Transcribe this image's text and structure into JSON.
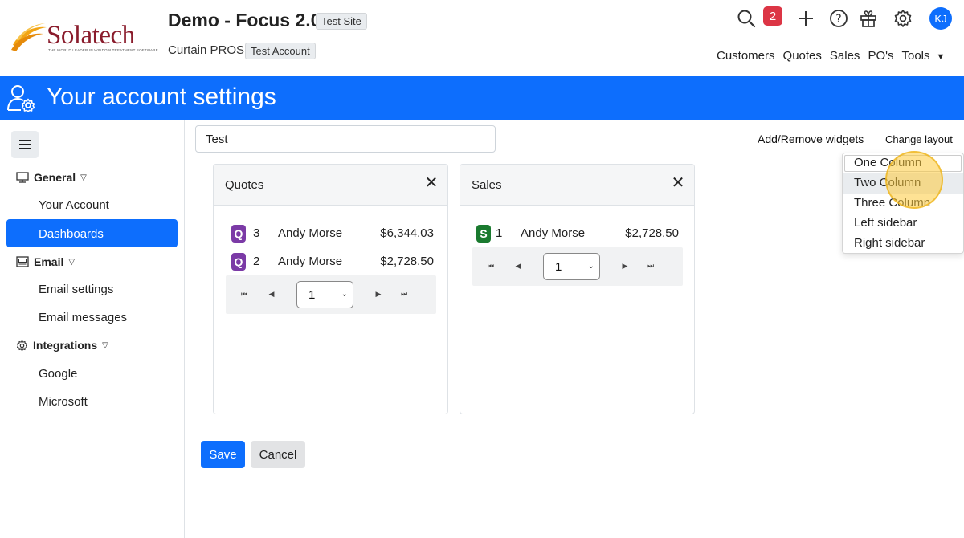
{
  "header": {
    "logo_text": "Solatech",
    "logo_tagline": "THE WORLD LEADER IN WINDOW TREATMENT SOFTWARE",
    "app_title": "Demo - Focus 2.0",
    "site_badge": "Test Site",
    "company": "Curtain PROS",
    "account_badge": "Test Account",
    "notification_count": "2",
    "avatar_initials": "KJ",
    "icons": [
      "search-icon",
      "plus-icon",
      "help-icon",
      "gift-icon",
      "gear-icon"
    ],
    "nav": [
      "Customers",
      "Quotes",
      "Sales",
      "PO's",
      "Tools"
    ]
  },
  "titlebar": {
    "title": "Your account settings",
    "icon": "user-gear-icon",
    "color": "#0d6efd"
  },
  "sidebar": {
    "sections": [
      {
        "label": "General",
        "icon": "monitor-icon",
        "items": [
          "Your Account",
          "Dashboards"
        ]
      },
      {
        "label": "Email",
        "icon": "email-icon",
        "items": [
          "Email settings",
          "Email messages"
        ]
      },
      {
        "label": "Integrations",
        "icon": "gear-icon",
        "items": [
          "Google",
          "Microsoft"
        ]
      }
    ],
    "active_item": "Dashboards"
  },
  "main": {
    "dashboard_name_value": "Test",
    "add_remove_widgets": "Add/Remove widgets",
    "change_layout": "Change layout",
    "layout_options": [
      "One Column",
      "Two Column",
      "Three Column",
      "Left sidebar",
      "Right sidebar"
    ],
    "hovered_option": "Two Column",
    "widgets": [
      {
        "title": "Quotes",
        "rows": [
          {
            "badge": "Q",
            "count": "3",
            "name": "Andy Morse",
            "amount": "$6,344.03"
          },
          {
            "badge": "Q",
            "count": "2",
            "name": "Andy Morse",
            "amount": "$2,728.50"
          }
        ],
        "page": "1"
      },
      {
        "title": "Sales",
        "rows": [
          {
            "badge": "S",
            "count": "1",
            "name": "Andy Morse",
            "amount": "$2,728.50"
          }
        ],
        "page": "1"
      }
    ],
    "save_label": "Save",
    "cancel_label": "Cancel"
  }
}
